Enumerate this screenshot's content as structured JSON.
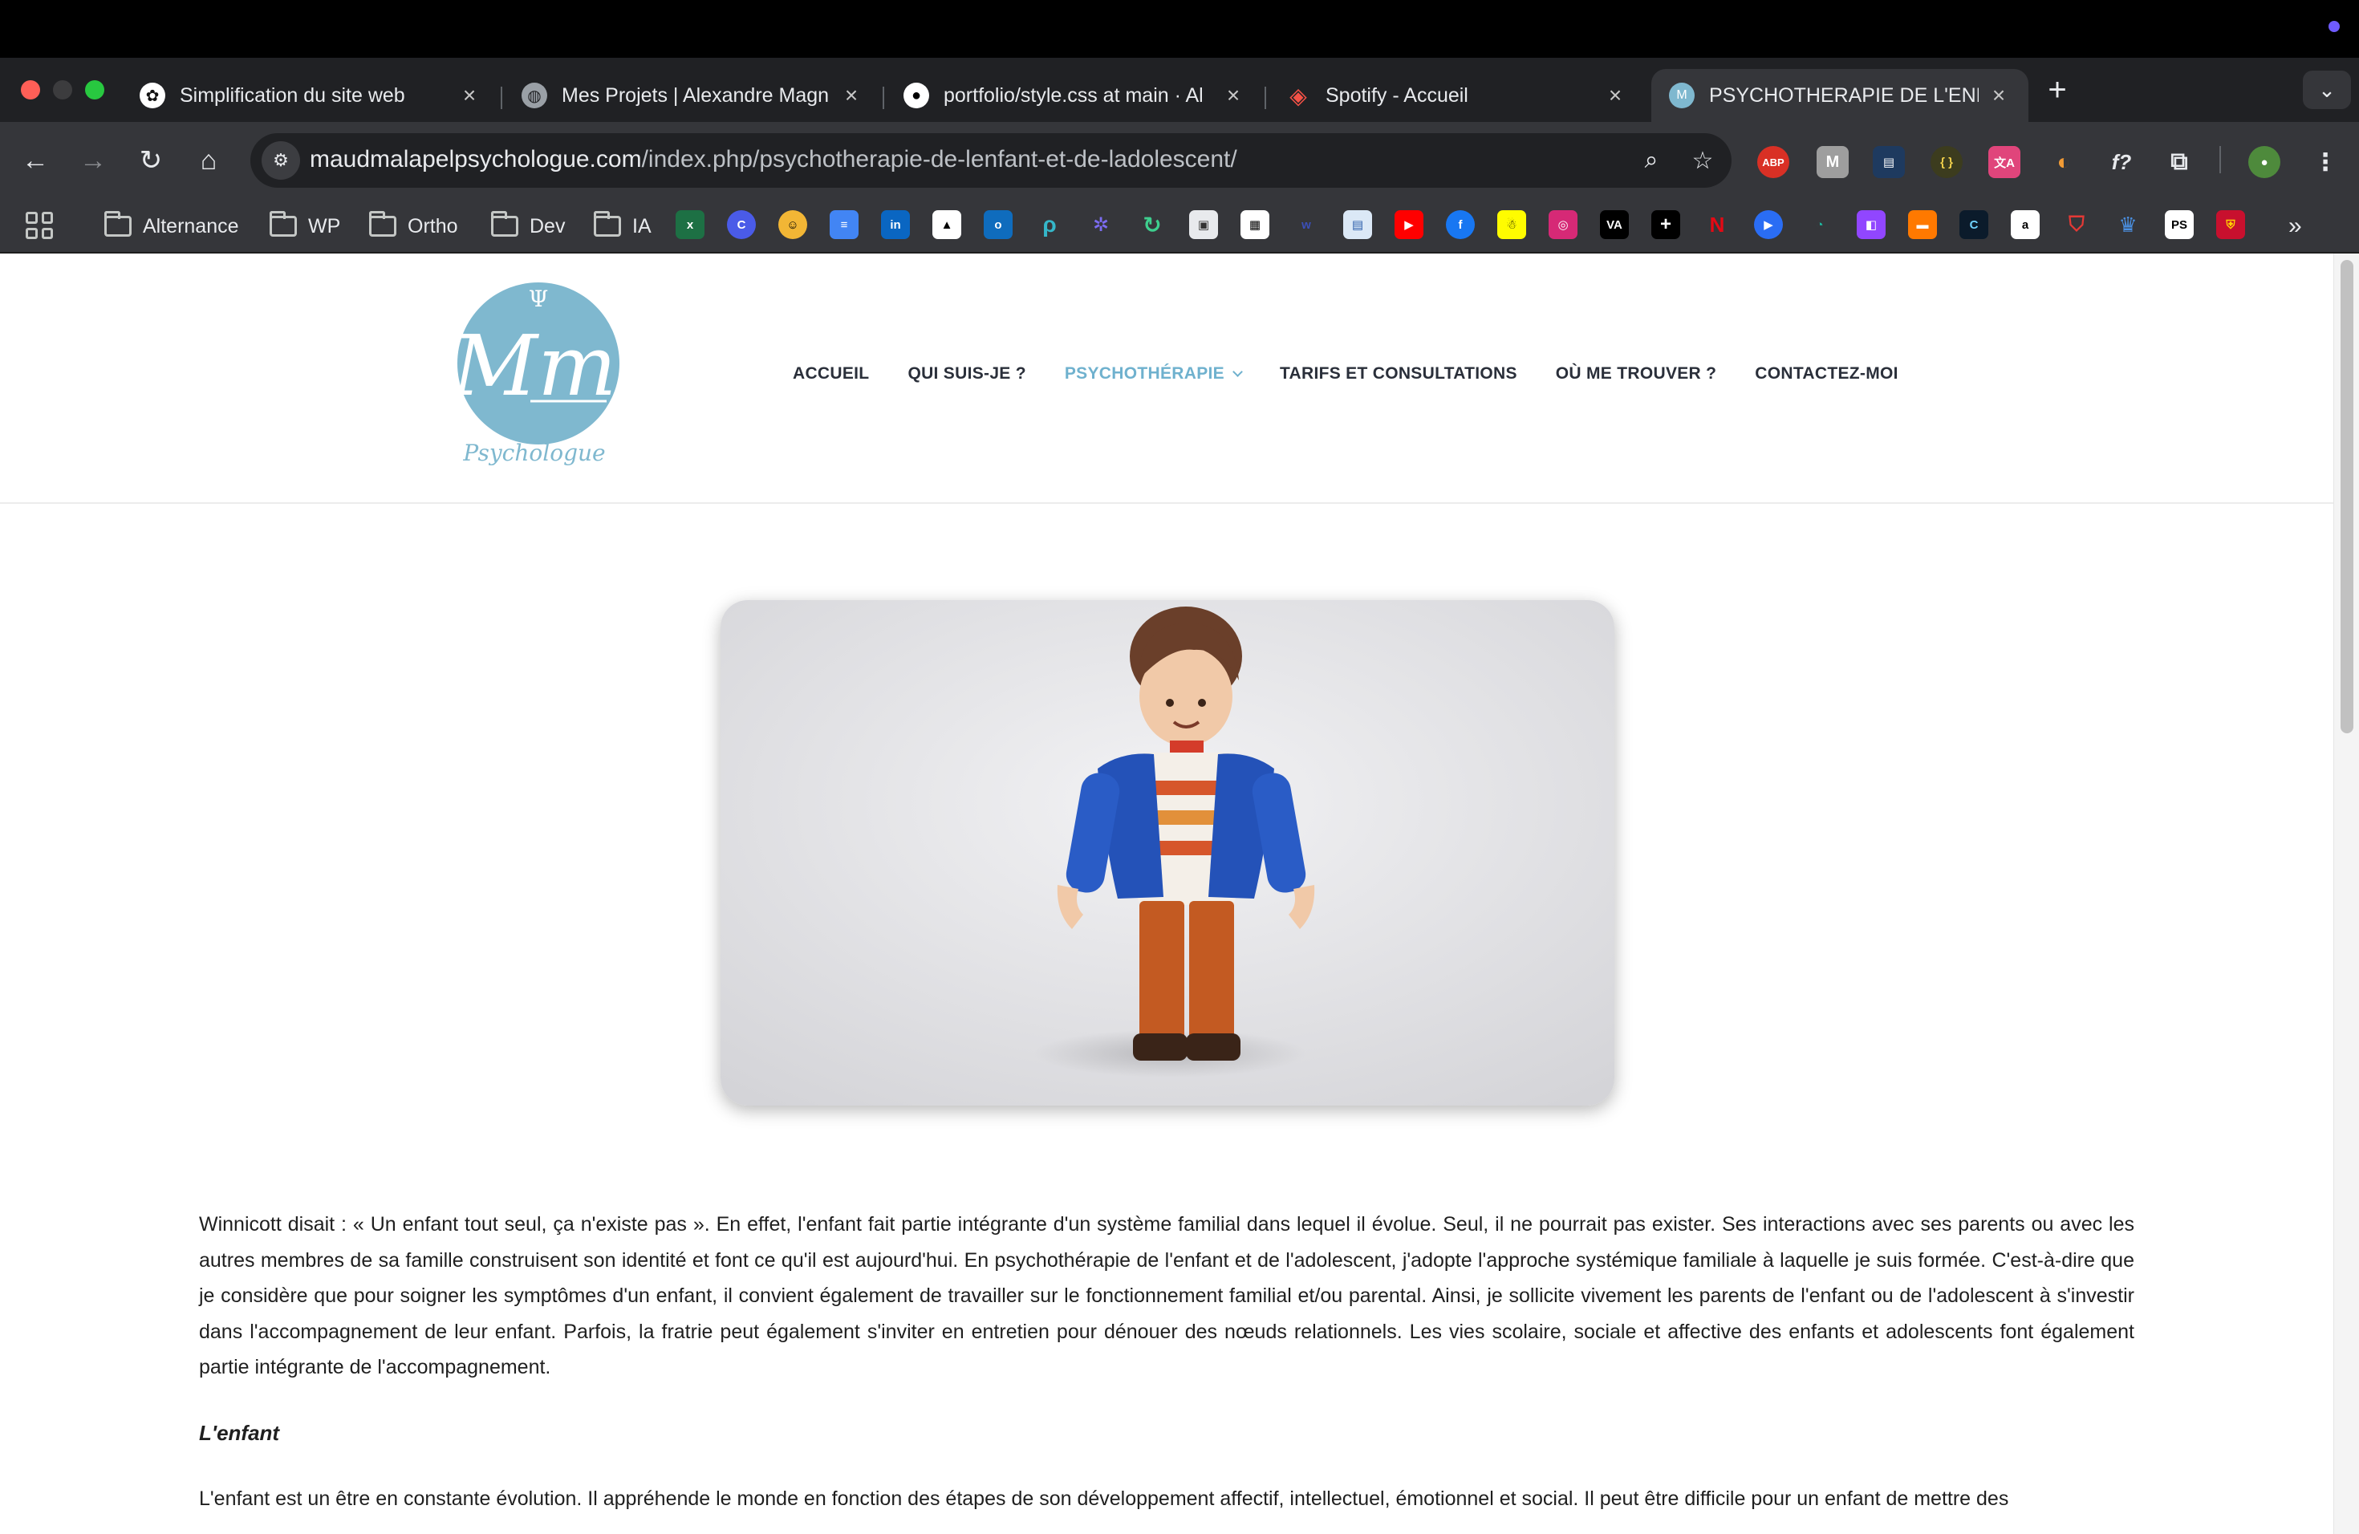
{
  "browser": {
    "tabs": [
      {
        "title": "Simplification du site web",
        "icon": "openai-icon",
        "active": false
      },
      {
        "title": "Mes Projets | Alexandre Magn",
        "icon": "globe-icon",
        "active": false
      },
      {
        "title": "portfolio/style.css at main · Al",
        "icon": "github-icon",
        "active": false
      },
      {
        "title": "Spotify - Accueil",
        "icon": "laravel-icon",
        "active": false
      },
      {
        "title": "PSYCHOTHERAPIE DE L'ENFA",
        "icon": "site-logo-icon",
        "active": true
      }
    ],
    "address_bar": {
      "domain": "maudmalapelpsychologue.com",
      "path": "/index.php/psychotherapie-de-lenfant-et-de-ladolescent/"
    },
    "extensions": [
      "ABP",
      "M",
      "ext-bars",
      "{ }",
      "translate",
      "ext-moon",
      "f?",
      "puzzle",
      "profile"
    ],
    "bookmarks": {
      "folders": [
        "Alternance",
        "WP",
        "Ortho",
        "Dev",
        "IA"
      ],
      "more_label": "»"
    }
  },
  "site": {
    "logo": {
      "symbol": "Ψ",
      "monogram": "Mm",
      "caption": "Psychologue",
      "color": "#7fb8cf"
    },
    "menu": [
      {
        "label": "ACCUEIL",
        "current": false
      },
      {
        "label": "QUI SUIS-JE ?",
        "current": false
      },
      {
        "label": "PSYCHOTHÉRAPIE",
        "current": true
      },
      {
        "label": "TARIFS ET CONSULTATIONS",
        "current": false
      },
      {
        "label": "OÙ ME TROUVER ?",
        "current": false
      },
      {
        "label": "CONTACTEZ-MOI",
        "current": false
      }
    ],
    "accent_color": "#6fb1ce",
    "content": {
      "intro": "Winnicott disait : « Un enfant tout seul, ça n'existe pas ». En effet, l'enfant fait partie intégrante d'un système familial dans lequel il évolue. Seul, il ne pourrait pas exister. Ses interactions avec ses parents ou avec les autres membres de sa famille construisent son identité et font ce qu'il est aujourd'hui. En psychothérapie de l'enfant et de l'adolescent, j'adopte l'approche systémique familiale à laquelle je suis formée. C'est-à-dire que je considère que pour soigner les symptômes d'un enfant, il convient également de travailler sur le fonctionnement familial et/ou parental. Ainsi, je sollicite vivement les parents de l'enfant ou de l'adolescent à s'investir dans l'accompagnement de leur enfant. Parfois, la fratrie peut également s'inviter en entretien pour dénouer des nœuds relationnels. Les vies scolaire, sociale et affective des enfants et adolescents font également partie intégrante de l'accompagnement.",
      "section_title": "L'enfant",
      "section_text": "L'enfant est un être en constante évolution. Il appréhende le monde en fonction des étapes de son développement affectif, intellectuel, émotionnel et social. Il peut être difficile pour un enfant de mettre des"
    }
  }
}
